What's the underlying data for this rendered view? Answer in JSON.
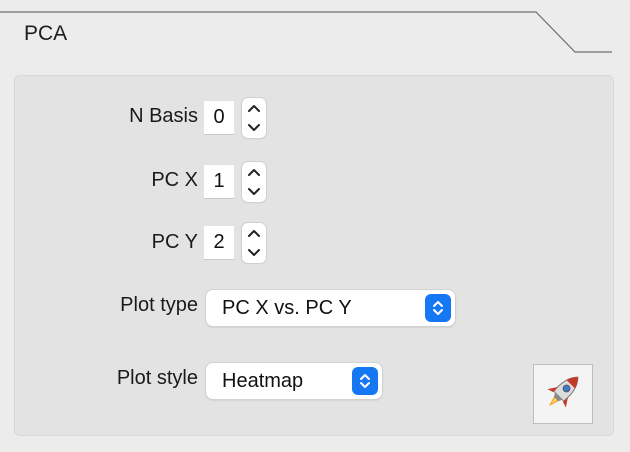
{
  "tab": {
    "title": "PCA"
  },
  "fields": {
    "n_basis": {
      "label": "N Basis",
      "value": "0"
    },
    "pc_x": {
      "label": "PC X",
      "value": "1"
    },
    "pc_y": {
      "label": "PC Y",
      "value": "2"
    }
  },
  "plot_type": {
    "label": "Plot type",
    "selected": "PC X vs. PC Y"
  },
  "plot_style": {
    "label": "Plot style",
    "selected": "Heatmap"
  },
  "colors": {
    "background": "#ececec",
    "panel": "#e3e3e3",
    "accent": "#1677f2"
  },
  "icons": {
    "run": "rocket-icon",
    "stepper_up": "chevron-up-icon",
    "stepper_down": "chevron-down-icon",
    "select": "up-down-arrows-icon"
  }
}
